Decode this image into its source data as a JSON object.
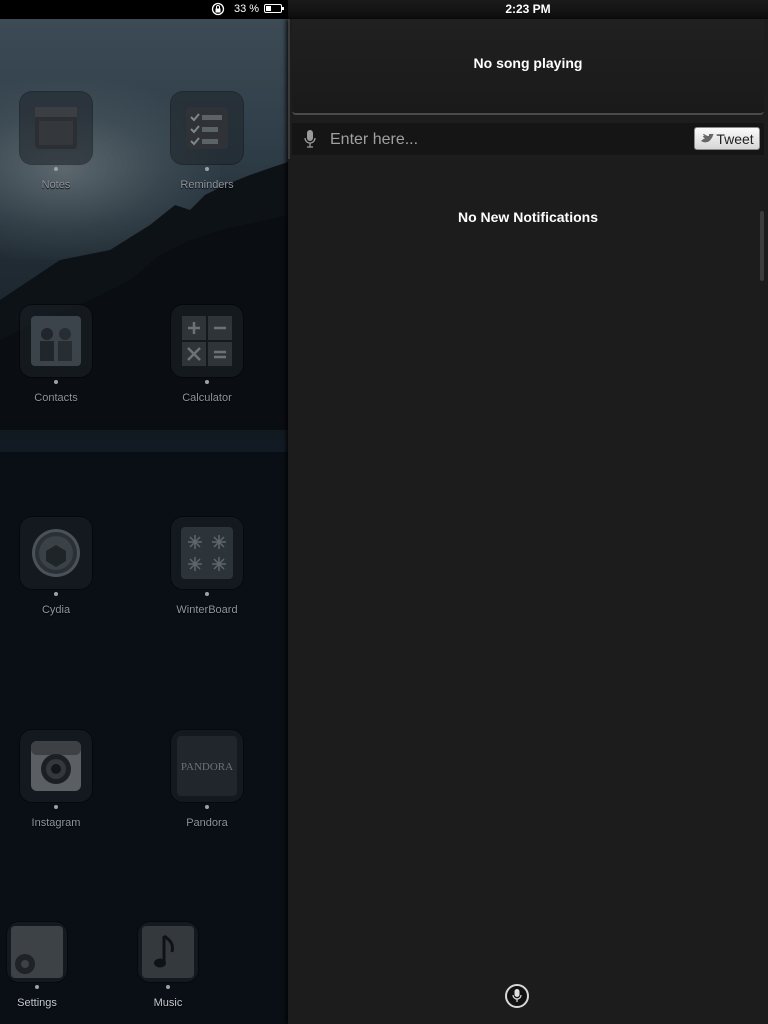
{
  "status_bar": {
    "battery_percent": "33 %",
    "time": "2:23 PM",
    "battery_level": 0.33
  },
  "home_screen": {
    "apps": [
      {
        "label": "Notes",
        "icon": "notes-icon"
      },
      {
        "label": "Reminders",
        "icon": "reminders-icon"
      },
      {
        "label": "Contacts",
        "icon": "contacts-icon"
      },
      {
        "label": "Calculator",
        "icon": "calculator-icon"
      },
      {
        "label": "Cydia",
        "icon": "cydia-icon"
      },
      {
        "label": "WinterBoard",
        "icon": "winterboard-icon"
      },
      {
        "label": "Instagram",
        "icon": "instagram-icon"
      },
      {
        "label": "Pandora",
        "icon": "pandora-icon"
      }
    ],
    "dock": [
      {
        "label": "Settings",
        "icon": "gear-icon"
      },
      {
        "label": "Music",
        "icon": "music-note-icon"
      }
    ]
  },
  "notification_center": {
    "now_playing": "No song playing",
    "tweet_placeholder": "Enter here...",
    "tweet_button": "Tweet",
    "empty_message": "No New Notifications"
  },
  "colors": {
    "panel_bg": "#1d1d1d",
    "text": "#ffffff",
    "label_dim": "#8c949b"
  }
}
